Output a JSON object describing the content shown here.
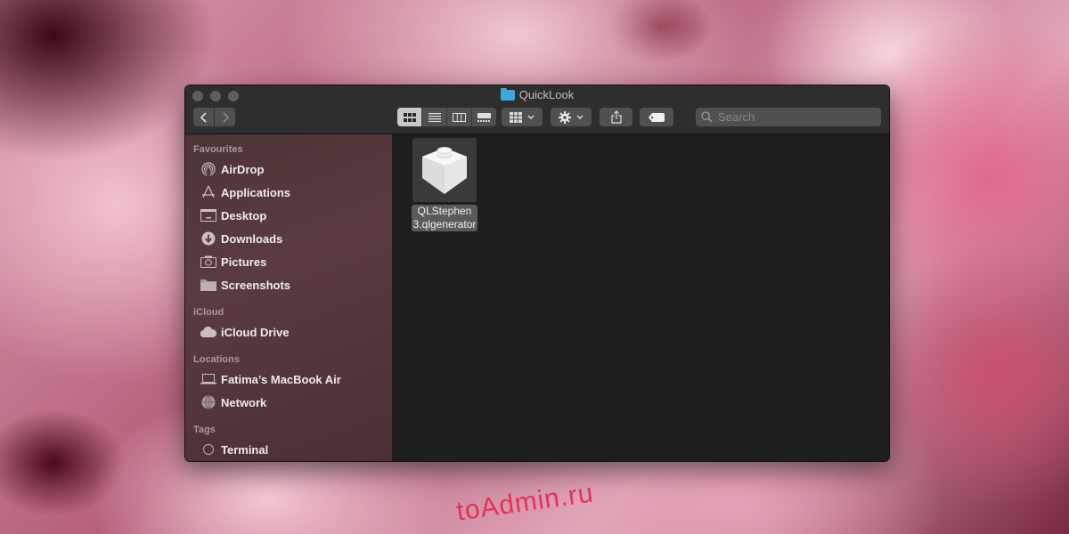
{
  "window": {
    "title": "QuickLook",
    "title_icon": "folder-icon"
  },
  "toolbar": {
    "back_label": "‹",
    "forward_label": "›",
    "views": [
      {
        "name": "icon-view",
        "icon": "grid-icon",
        "active": true
      },
      {
        "name": "list-view",
        "icon": "list-icon",
        "active": false
      },
      {
        "name": "column-view",
        "icon": "columns-icon",
        "active": false
      },
      {
        "name": "gallery-view",
        "icon": "gallery-icon",
        "active": false
      }
    ],
    "arrange_icon": "grid-icon",
    "action_icon": "gear-icon",
    "share_icon": "share-icon",
    "tag_icon": "tag-icon",
    "search_placeholder": "Search"
  },
  "sidebar": {
    "sections": [
      {
        "label": "Favourites",
        "items": [
          {
            "label": "AirDrop",
            "icon": "airdrop-icon"
          },
          {
            "label": "Applications",
            "icon": "applications-icon"
          },
          {
            "label": "Desktop",
            "icon": "desktop-icon"
          },
          {
            "label": "Downloads",
            "icon": "downloads-icon"
          },
          {
            "label": "Pictures",
            "icon": "camera-icon"
          },
          {
            "label": "Screenshots",
            "icon": "folder-icon"
          }
        ]
      },
      {
        "label": "iCloud",
        "items": [
          {
            "label": "iCloud Drive",
            "icon": "cloud-icon"
          }
        ]
      },
      {
        "label": "Locations",
        "items": [
          {
            "label": "Fatima’s MacBook Air",
            "icon": "laptop-icon"
          },
          {
            "label": "Network",
            "icon": "network-icon"
          }
        ]
      },
      {
        "label": "Tags",
        "items": [
          {
            "label": "Terminal",
            "icon": "tag-circle-icon"
          }
        ]
      }
    ]
  },
  "files": [
    {
      "name_line1": "QLStephen",
      "name_line2": "3.qlgenerator",
      "icon": "plugin-icon",
      "selected": true
    }
  ],
  "watermark": "toAdmin.ru"
}
